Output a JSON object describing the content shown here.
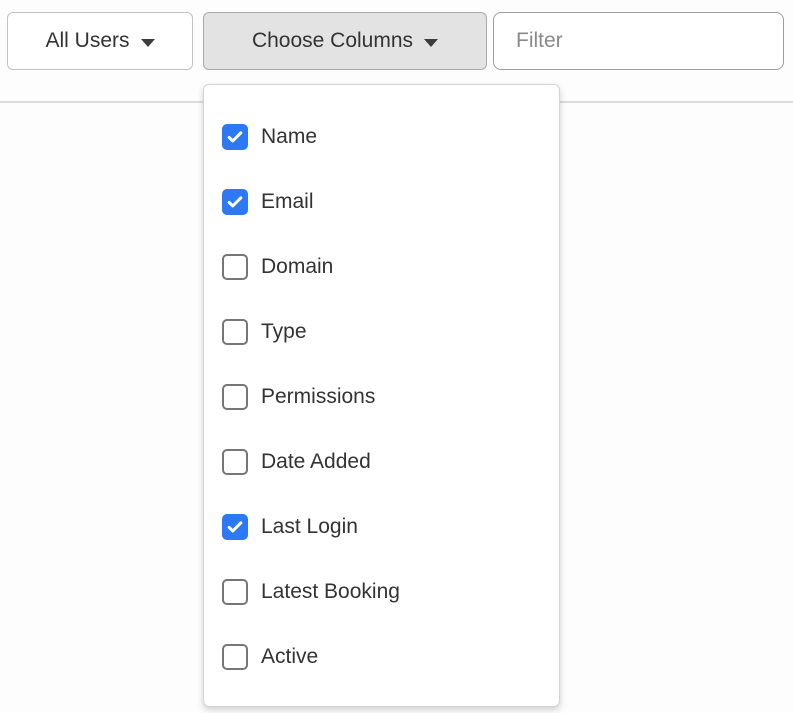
{
  "toolbar": {
    "user_filter_button": {
      "label": "All Users"
    },
    "choose_columns_button": {
      "label": "Choose Columns"
    },
    "filter_input": {
      "placeholder": "Filter",
      "value": ""
    }
  },
  "columns_dropdown": {
    "items": [
      {
        "label": "Name",
        "checked": true
      },
      {
        "label": "Email",
        "checked": true
      },
      {
        "label": "Domain",
        "checked": false
      },
      {
        "label": "Type",
        "checked": false
      },
      {
        "label": "Permissions",
        "checked": false
      },
      {
        "label": "Date Added",
        "checked": false
      },
      {
        "label": "Last Login",
        "checked": true
      },
      {
        "label": "Latest Booking",
        "checked": false
      },
      {
        "label": "Active",
        "checked": false
      }
    ]
  },
  "colors": {
    "checkbox_checked": "#2d79f3",
    "button_active_bg": "#e3e3e3",
    "divider": "#dcdcdc",
    "text": "#333333"
  }
}
